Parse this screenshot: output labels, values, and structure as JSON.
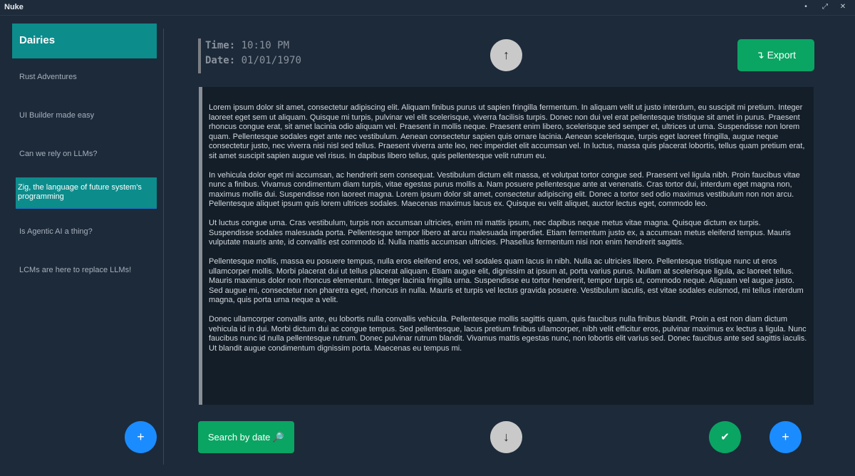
{
  "window": {
    "title": "Nuke",
    "minimize_glyph": "•",
    "maximize_glyph": "⤢",
    "close_glyph": "✕"
  },
  "sidebar": {
    "header": "Dairies",
    "items": [
      {
        "label": "Rust Adventures",
        "active": false
      },
      {
        "label": "UI Builder made easy",
        "active": false
      },
      {
        "label": "Can we rely on LLMs?",
        "active": false
      },
      {
        "label": "Zig, the language of future system's programming",
        "active": true
      },
      {
        "label": "Is Agentic AI a thing?",
        "active": false
      },
      {
        "label": "LCMs are here to replace LLMs!",
        "active": false
      }
    ],
    "add_glyph": "+"
  },
  "entry": {
    "time_label": "Time:",
    "time_value": "10:10 PM",
    "date_label": "Date:",
    "date_value": "01/01/1970",
    "paragraphs": [
      "Lorem ipsum dolor sit amet, consectetur adipiscing elit. Aliquam finibus purus ut sapien fringilla fermentum. In aliquam velit ut justo interdum, eu suscipit mi pretium. Integer laoreet eget sem ut aliquam. Quisque mi turpis, pulvinar vel elit scelerisque, viverra facilisis turpis. Donec non dui vel erat pellentesque tristique sit amet in purus. Praesent rhoncus congue erat, sit amet lacinia odio aliquam vel. Praesent in mollis neque. Praesent enim libero, scelerisque sed semper et, ultrices ut urna. Suspendisse non lorem quam. Pellentesque sodales eget ante nec vestibulum. Aenean consectetur sapien quis ornare lacinia. Aenean scelerisque, turpis eget laoreet fringilla, augue neque consectetur justo, nec viverra nisi nisl sed tellus. Praesent viverra ante leo, nec imperdiet elit accumsan vel. In luctus, massa quis placerat lobortis, tellus quam pretium erat, sit amet suscipit sapien augue vel risus. In dapibus libero tellus, quis pellentesque velit rutrum eu.",
      "In vehicula dolor eget mi accumsan, ac hendrerit sem consequat. Vestibulum dictum elit massa, et volutpat tortor congue sed. Praesent vel ligula nibh. Proin faucibus vitae nunc a finibus. Vivamus condimentum diam turpis, vitae egestas purus mollis a. Nam posuere pellentesque ante at venenatis. Cras tortor dui, interdum eget magna non, maximus mollis dui. Suspendisse non laoreet magna. Lorem ipsum dolor sit amet, consectetur adipiscing elit. Donec a tortor sed odio maximus vestibulum non non arcu. Pellentesque aliquet ipsum quis lorem ultrices sodales. Maecenas maximus lacus ex. Quisque eu velit aliquet, auctor lectus eget, commodo leo.",
      "Ut luctus congue urna. Cras vestibulum, turpis non accumsan ultricies, enim mi mattis ipsum, nec dapibus neque metus vitae magna. Quisque dictum ex turpis. Suspendisse sodales malesuada porta. Pellentesque tempor libero at arcu malesuada imperdiet. Etiam fermentum justo ex, a accumsan metus eleifend tempus. Mauris vulputate mauris ante, id convallis est commodo id. Nulla mattis accumsan ultricies. Phasellus fermentum nisi non enim hendrerit sagittis.",
      "Pellentesque mollis, massa eu posuere tempus, nulla eros eleifend eros, vel sodales quam lacus in nibh. Nulla ac ultricies libero. Pellentesque tristique nunc ut eros ullamcorper mollis. Morbi placerat dui ut tellus placerat aliquam. Etiam augue elit, dignissim at ipsum at, porta varius purus. Nullam at scelerisque ligula, ac laoreet tellus. Mauris maximus dolor non rhoncus elementum. Integer lacinia fringilla urna. Suspendisse eu tortor hendrerit, tempor turpis ut, commodo neque. Aliquam vel augue justo. Sed augue mi, consectetur non pharetra eget, rhoncus in nulla. Mauris et turpis vel lectus gravida posuere. Vestibulum iaculis, est vitae sodales euismod, mi tellus interdum magna, quis porta urna neque a velit.",
      "Donec ullamcorper convallis ante, eu lobortis nulla convallis vehicula. Pellentesque mollis sagittis quam, quis faucibus nulla finibus blandit. Proin a est non diam dictum vehicula id in dui. Morbi dictum dui ac congue tempus. Sed pellentesque, lacus pretium finibus ullamcorper, nibh velit efficitur eros, pulvinar maximus ex lectus a ligula. Nunc faucibus nunc id nulla pellentesque rutrum. Donec pulvinar rutrum blandit. Vivamus mattis egestas nunc, non lobortis elit varius sed. Donec faucibus ante sed sagittis iaculis. Ut blandit augue condimentum dignissim porta. Maecenas eu tempus mi."
    ]
  },
  "toolbar": {
    "up_glyph": "↑",
    "down_glyph": "↓",
    "export_label": "↴ Export",
    "search_label": "Search by date 🔎",
    "confirm_glyph": "✔",
    "add_glyph": "+"
  },
  "colors": {
    "accent_teal": "#0d8c8c",
    "accent_green": "#0aa563",
    "accent_blue": "#1a8cff",
    "background": "#1d2a3a"
  }
}
